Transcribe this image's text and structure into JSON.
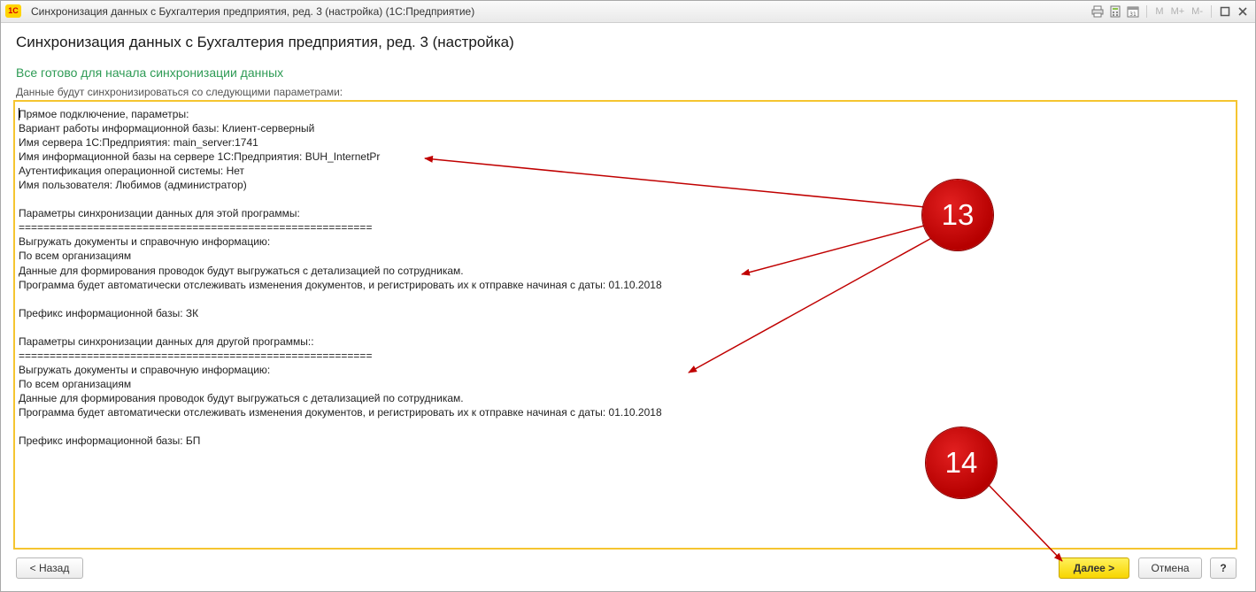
{
  "window": {
    "app_logo": "1С",
    "title": "Синхронизация данных с Бухгалтерия предприятия, ред. 3 (настройка)  (1С:Предприятие)",
    "toolbar": {
      "m": "M",
      "m_plus": "M+",
      "m_minus": "M-"
    }
  },
  "form": {
    "heading": "Синхронизация данных с Бухгалтерия предприятия, ред. 3 (настройка)",
    "subheading": "Все готово для начала синхронизации данных",
    "caption": "Данные будут синхронизироваться со следующими параметрами:",
    "summary_lines": [
      "Прямое подключение, параметры:",
      "Вариант работы информационной базы: Клиент-серверный",
      "Имя сервера 1С:Предприятия: main_server:1741",
      "Имя информационной базы на сервере 1С:Предприятия: BUH_InternetPr",
      "Аутентификация операционной системы: Нет",
      "Имя пользователя: Любимов (администратор)",
      "",
      "Параметры синхронизации данных для этой программы:",
      "=========================================================",
      "Выгружать документы и справочную информацию:",
      "По всем организациям",
      "Данные для формирования проводок будут выгружаться с детализацией по сотрудникам.",
      "Программа будет автоматически отслеживать изменения документов, и регистрировать их к отправке начиная с даты: 01.10.2018",
      "",
      "Префикс информационной базы: ЗК",
      "",
      "Параметры синхронизации данных для другой программы::",
      "=========================================================",
      "Выгружать документы и справочную информацию:",
      "По всем организациям",
      "Данные для формирования проводок будут выгружаться с детализацией по сотрудникам.",
      "Программа будет автоматически отслеживать изменения документов, и регистрировать их к отправке начиная с даты: 01.10.2018",
      "",
      "Префикс информационной базы: БП"
    ]
  },
  "buttons": {
    "back": "< Назад",
    "next": "Далее >",
    "cancel": "Отмена",
    "help": "?"
  },
  "annotations": {
    "marker_13": "13",
    "marker_14": "14"
  },
  "colors": {
    "accent_green": "#2e9b55",
    "highlight_border": "#f5c530",
    "marker_red": "#c00000"
  }
}
